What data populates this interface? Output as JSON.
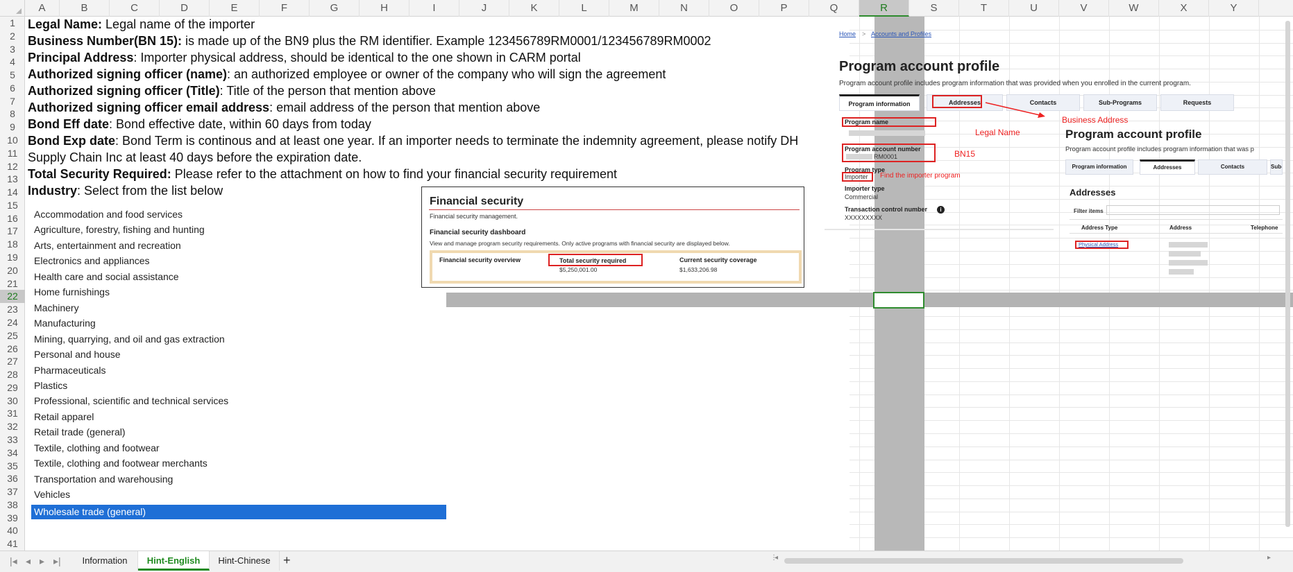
{
  "columns": [
    "A",
    "B",
    "C",
    "D",
    "E",
    "F",
    "G",
    "H",
    "I",
    "J",
    "K",
    "L",
    "M",
    "N",
    "O",
    "P",
    "Q",
    "R",
    "S",
    "T",
    "U",
    "V",
    "W",
    "X",
    "Y"
  ],
  "active_column": "R",
  "rows": [
    "1",
    "2",
    "3",
    "4",
    "5",
    "6",
    "7",
    "8",
    "9",
    "10",
    "11",
    "12",
    "13",
    "14",
    "15",
    "16",
    "17",
    "18",
    "19",
    "20",
    "21",
    "22",
    "23",
    "24",
    "25",
    "26",
    "27",
    "28",
    "29",
    "30",
    "31",
    "32",
    "33",
    "34",
    "35",
    "36",
    "37",
    "38",
    "39",
    "40",
    "41"
  ],
  "active_row": "22",
  "lines": [
    {
      "bold": "Legal Name:",
      "text": " Legal name of the importer"
    },
    {
      "bold": "Business Number(BN 15):",
      "text": " is made up of the BN9 plus the RM identifier. Example 123456789RM0001/123456789RM0002"
    },
    {
      "bold": "Principal Address",
      "text": ": Importer physical address, should be identical to the one shown in CARM portal"
    },
    {
      "bold": "Authorized signing officer (name)",
      "text": ": an authorized employee or owner of the company who will sign the agreement"
    },
    {
      "bold": "Authorized signing officer (Title)",
      "text": ": Title of the person that mention above"
    },
    {
      "bold": "Authorized signing officer email address",
      "text": ": email address of the person that mention above"
    },
    {
      "bold": "Bond Eff date",
      "text": ": Bond effective date, within 60 days from today"
    },
    {
      "bold": "Bond Exp date",
      "text": ": Bond Term is continous and at least one year. If an importer needs to terminate the indemnity agreement, please notify DH"
    },
    {
      "bold": "",
      "text": "Supply Chain Inc at least 40 days before the expiration date."
    },
    {
      "bold": "Total Security Required:",
      "text": " Please refer to the attachment on how to find your financial security requirement"
    },
    {
      "bold": "Industry",
      "text": ": Select from the list below"
    }
  ],
  "industries": [
    "Accommodation and food services",
    "Agriculture, forestry, fishing and hunting",
    "Arts, entertainment and recreation",
    "Electronics and appliances",
    "Health care and social assistance",
    "Home furnishings",
    "Machinery",
    "Manufacturing",
    "Mining, quarrying, and oil and gas extraction",
    "Personal and house",
    "Pharmaceuticals",
    "Plastics",
    "Professional, scientific and technical services",
    "Retail apparel",
    "Retail trade (general)",
    "Textile, clothing and footwear",
    "Textile, clothing and footwear merchants",
    "Transportation and warehousing",
    "Vehicles",
    "Wholesale trade (general)"
  ],
  "selected_industry": "Wholesale trade (general)",
  "financial_security": {
    "title": "Financial security",
    "subtitle": "Financial security management.",
    "dashboard": "Financial security dashboard",
    "description": "View and manage program security requirements. Only active programs with financial security are displayed below.",
    "col1": "Financial security overview",
    "col2": "Total security required",
    "col2_value": "$5,250,001.00",
    "col3": "Current security coverage",
    "col3_value": "$1,633,206.98"
  },
  "program_account": {
    "breadcrumb_home": "Home",
    "breadcrumb_sep": ">",
    "breadcrumb_accounts": "Accounts and Profiles",
    "title": "Program account profile",
    "description": "Program account profile includes program information that was provided when you enrolled in the current program.",
    "tabs": [
      "Program information",
      "Addresses",
      "Contacts",
      "Sub-Programs",
      "Requests"
    ],
    "program_name_label": "Program name",
    "legal_name_annot": "Legal Name",
    "account_number_label": "Program account number",
    "account_number_value": "RM0001",
    "bn15_annot": "BN15",
    "program_type_label": "Program type",
    "program_type_value": "Importer",
    "program_type_annot": "Find the importer program",
    "importer_type_label": "Importer type",
    "importer_type_value": "Commercial",
    "txn_label": "Transaction control number",
    "txn_value": "XXXXXXXXX",
    "business_address_annot": "Business Address",
    "title2": "Program account profile",
    "description2": "Program account profile includes program information that was p",
    "tabs2": [
      "Program information",
      "Addresses",
      "Contacts",
      "Sub-"
    ],
    "addresses_heading": "Addresses",
    "filter_label": "Filter items",
    "table_headers": [
      "Address Type",
      "Address",
      "Telephone"
    ],
    "physical_address": "Physical Address"
  },
  "sheet_tabs": [
    "Information",
    "Hint-English",
    "Hint-Chinese"
  ],
  "active_sheet": "Hint-English",
  "add_sheet_label": "+"
}
